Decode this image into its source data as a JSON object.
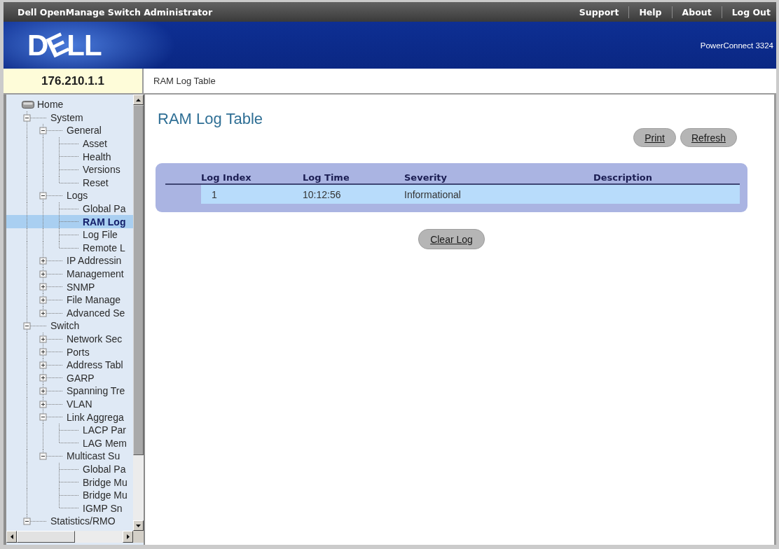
{
  "header": {
    "title": "Dell OpenManage Switch Administrator",
    "links": [
      "Support",
      "Help",
      "About",
      "Log Out"
    ]
  },
  "banner": {
    "logo": "DELL",
    "product": "PowerConnect 3324"
  },
  "address_bar": {
    "ip": "176.210.1.1",
    "breadcrumb": "RAM Log Table"
  },
  "sidebar": {
    "tree": [
      {
        "label": "Home",
        "selected": false,
        "children": [
          {
            "label": "System",
            "expanded": true,
            "selected": false,
            "children": [
              {
                "label": "General",
                "expanded": true,
                "selected": false,
                "children": [
                  {
                    "label": "Asset",
                    "selected": false
                  },
                  {
                    "label": "Health",
                    "selected": false
                  },
                  {
                    "label": "Versions",
                    "selected": false
                  },
                  {
                    "label": "Reset",
                    "selected": false
                  }
                ]
              },
              {
                "label": "Logs",
                "expanded": true,
                "selected": false,
                "children": [
                  {
                    "label": "Global Pa",
                    "selected": false
                  },
                  {
                    "label": "RAM Log",
                    "selected": true
                  },
                  {
                    "label": "Log File",
                    "selected": false
                  },
                  {
                    "label": "Remote L",
                    "selected": false
                  }
                ]
              },
              {
                "label": "IP Addressin",
                "expanded": false,
                "selected": false
              },
              {
                "label": "Management",
                "expanded": false,
                "selected": false
              },
              {
                "label": "SNMP",
                "expanded": false,
                "selected": false
              },
              {
                "label": "File Manage",
                "expanded": false,
                "selected": false
              },
              {
                "label": "Advanced Se",
                "expanded": false,
                "selected": false
              }
            ]
          },
          {
            "label": "Switch",
            "expanded": true,
            "selected": false,
            "children": [
              {
                "label": "Network Sec",
                "expanded": false,
                "selected": false
              },
              {
                "label": "Ports",
                "expanded": false,
                "selected": false
              },
              {
                "label": "Address Tabl",
                "expanded": false,
                "selected": false
              },
              {
                "label": "GARP",
                "expanded": false,
                "selected": false
              },
              {
                "label": "Spanning Tre",
                "expanded": false,
                "selected": false
              },
              {
                "label": "VLAN",
                "expanded": false,
                "selected": false
              },
              {
                "label": "Link Aggrega",
                "expanded": true,
                "selected": false,
                "children": [
                  {
                    "label": "LACP Par",
                    "selected": false
                  },
                  {
                    "label": "LAG Mem",
                    "selected": false
                  }
                ]
              },
              {
                "label": "Multicast Su",
                "expanded": true,
                "selected": false,
                "children": [
                  {
                    "label": "Global Pa",
                    "selected": false
                  },
                  {
                    "label": "Bridge Mu",
                    "selected": false
                  },
                  {
                    "label": "Bridge Mu",
                    "selected": false
                  },
                  {
                    "label": "IGMP Sn",
                    "selected": false
                  }
                ]
              }
            ]
          },
          {
            "label": "Statistics/RMO",
            "expanded": true,
            "selected": false
          }
        ]
      }
    ]
  },
  "main": {
    "title": "RAM Log Table",
    "buttons": [
      "Print",
      "Refresh"
    ],
    "table": {
      "columns": [
        "Log Index",
        "Log Time",
        "Severity",
        "Description"
      ],
      "rows": [
        [
          "1",
          "10:12:56",
          "Informational"
        ]
      ]
    },
    "clear_button": "Clear Log"
  }
}
